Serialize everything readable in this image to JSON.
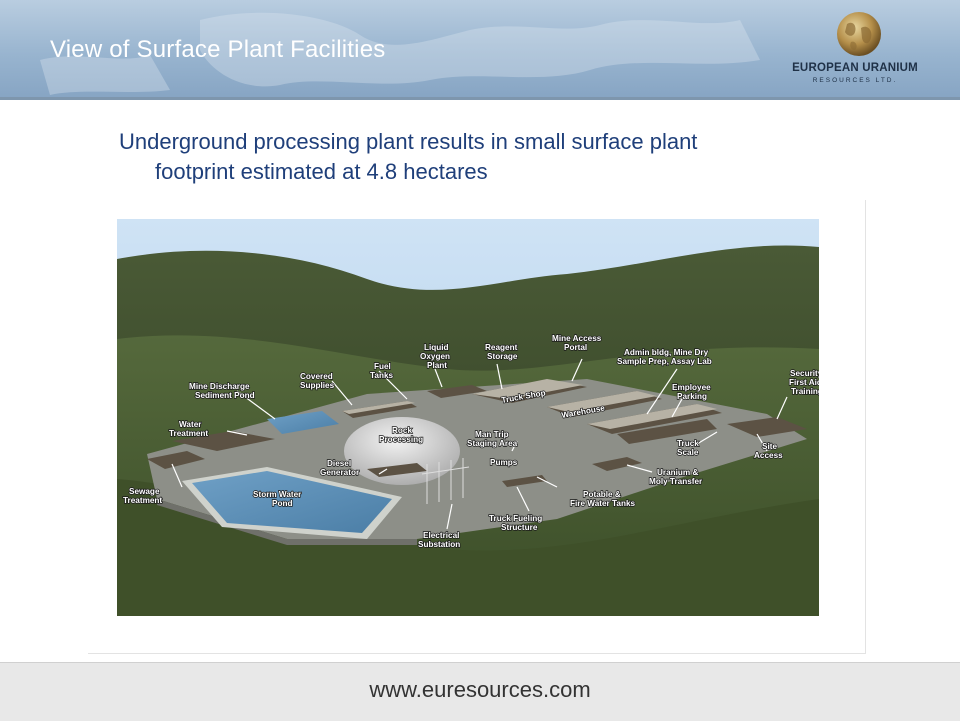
{
  "header": {
    "title": "View of Surface Plant Facilities",
    "logo_name": "EUROPEAN URANIUM",
    "logo_sub": "RESOURCES LTD."
  },
  "bullet": {
    "line1": "Underground processing plant results in small surface plant",
    "line2": "footprint  estimated at 4.8 hectares"
  },
  "diagram_labels": {
    "mine_discharge": [
      "Mine Discharge",
      "Sediment Pond"
    ],
    "covered_supplies": [
      "Covered",
      "Supplies"
    ],
    "fuel_tanks": [
      "Fuel",
      "Tanks"
    ],
    "liquid_oxygen": [
      "Liquid",
      "Oxygen",
      "Plant"
    ],
    "reagent_storage": [
      "Reagent",
      "Storage"
    ],
    "mine_access": [
      "Mine Access",
      "Portal"
    ],
    "admin_bldg": [
      "Admin bldg, Mine Dry",
      "Sample Prep, Assay Lab"
    ],
    "security": [
      "Security",
      "First Aid",
      "Training"
    ],
    "employee_parking": [
      "Employee",
      "Parking"
    ],
    "water_treatment": [
      "Water",
      "Treatment"
    ],
    "rock_processing": [
      "Rock",
      "Processing"
    ],
    "truck_shop": "Truck Shop",
    "warehouse": "Warehouse",
    "man_trip": [
      "Man Trip",
      "Staging Area"
    ],
    "truck_scale": [
      "Truck",
      "Scale"
    ],
    "site_access": [
      "Site",
      "Access"
    ],
    "diesel_generator": [
      "Diesel",
      "Generator"
    ],
    "pumps": "Pumps",
    "uranium_moly": [
      "Uranium &",
      "Moly Transfer"
    ],
    "sewage_treatment": [
      "Sewage",
      "Treatment"
    ],
    "storm_water_pond": [
      "Storm Water",
      "Pond"
    ],
    "potable_fire": [
      "Potable &",
      "Fire Water Tanks"
    ],
    "truck_fueling": [
      "Truck Fueling",
      "Structure"
    ],
    "electrical_substation": [
      "Electrical",
      "Substation"
    ]
  },
  "footer": {
    "url": "www.euresources.com"
  },
  "colors": {
    "title_text": "#ffffff",
    "bullet_text": "#1f3f7a",
    "banner": "#98b4cf",
    "hill_green": "#3d4f2c",
    "sky": "#b4d3ef"
  }
}
